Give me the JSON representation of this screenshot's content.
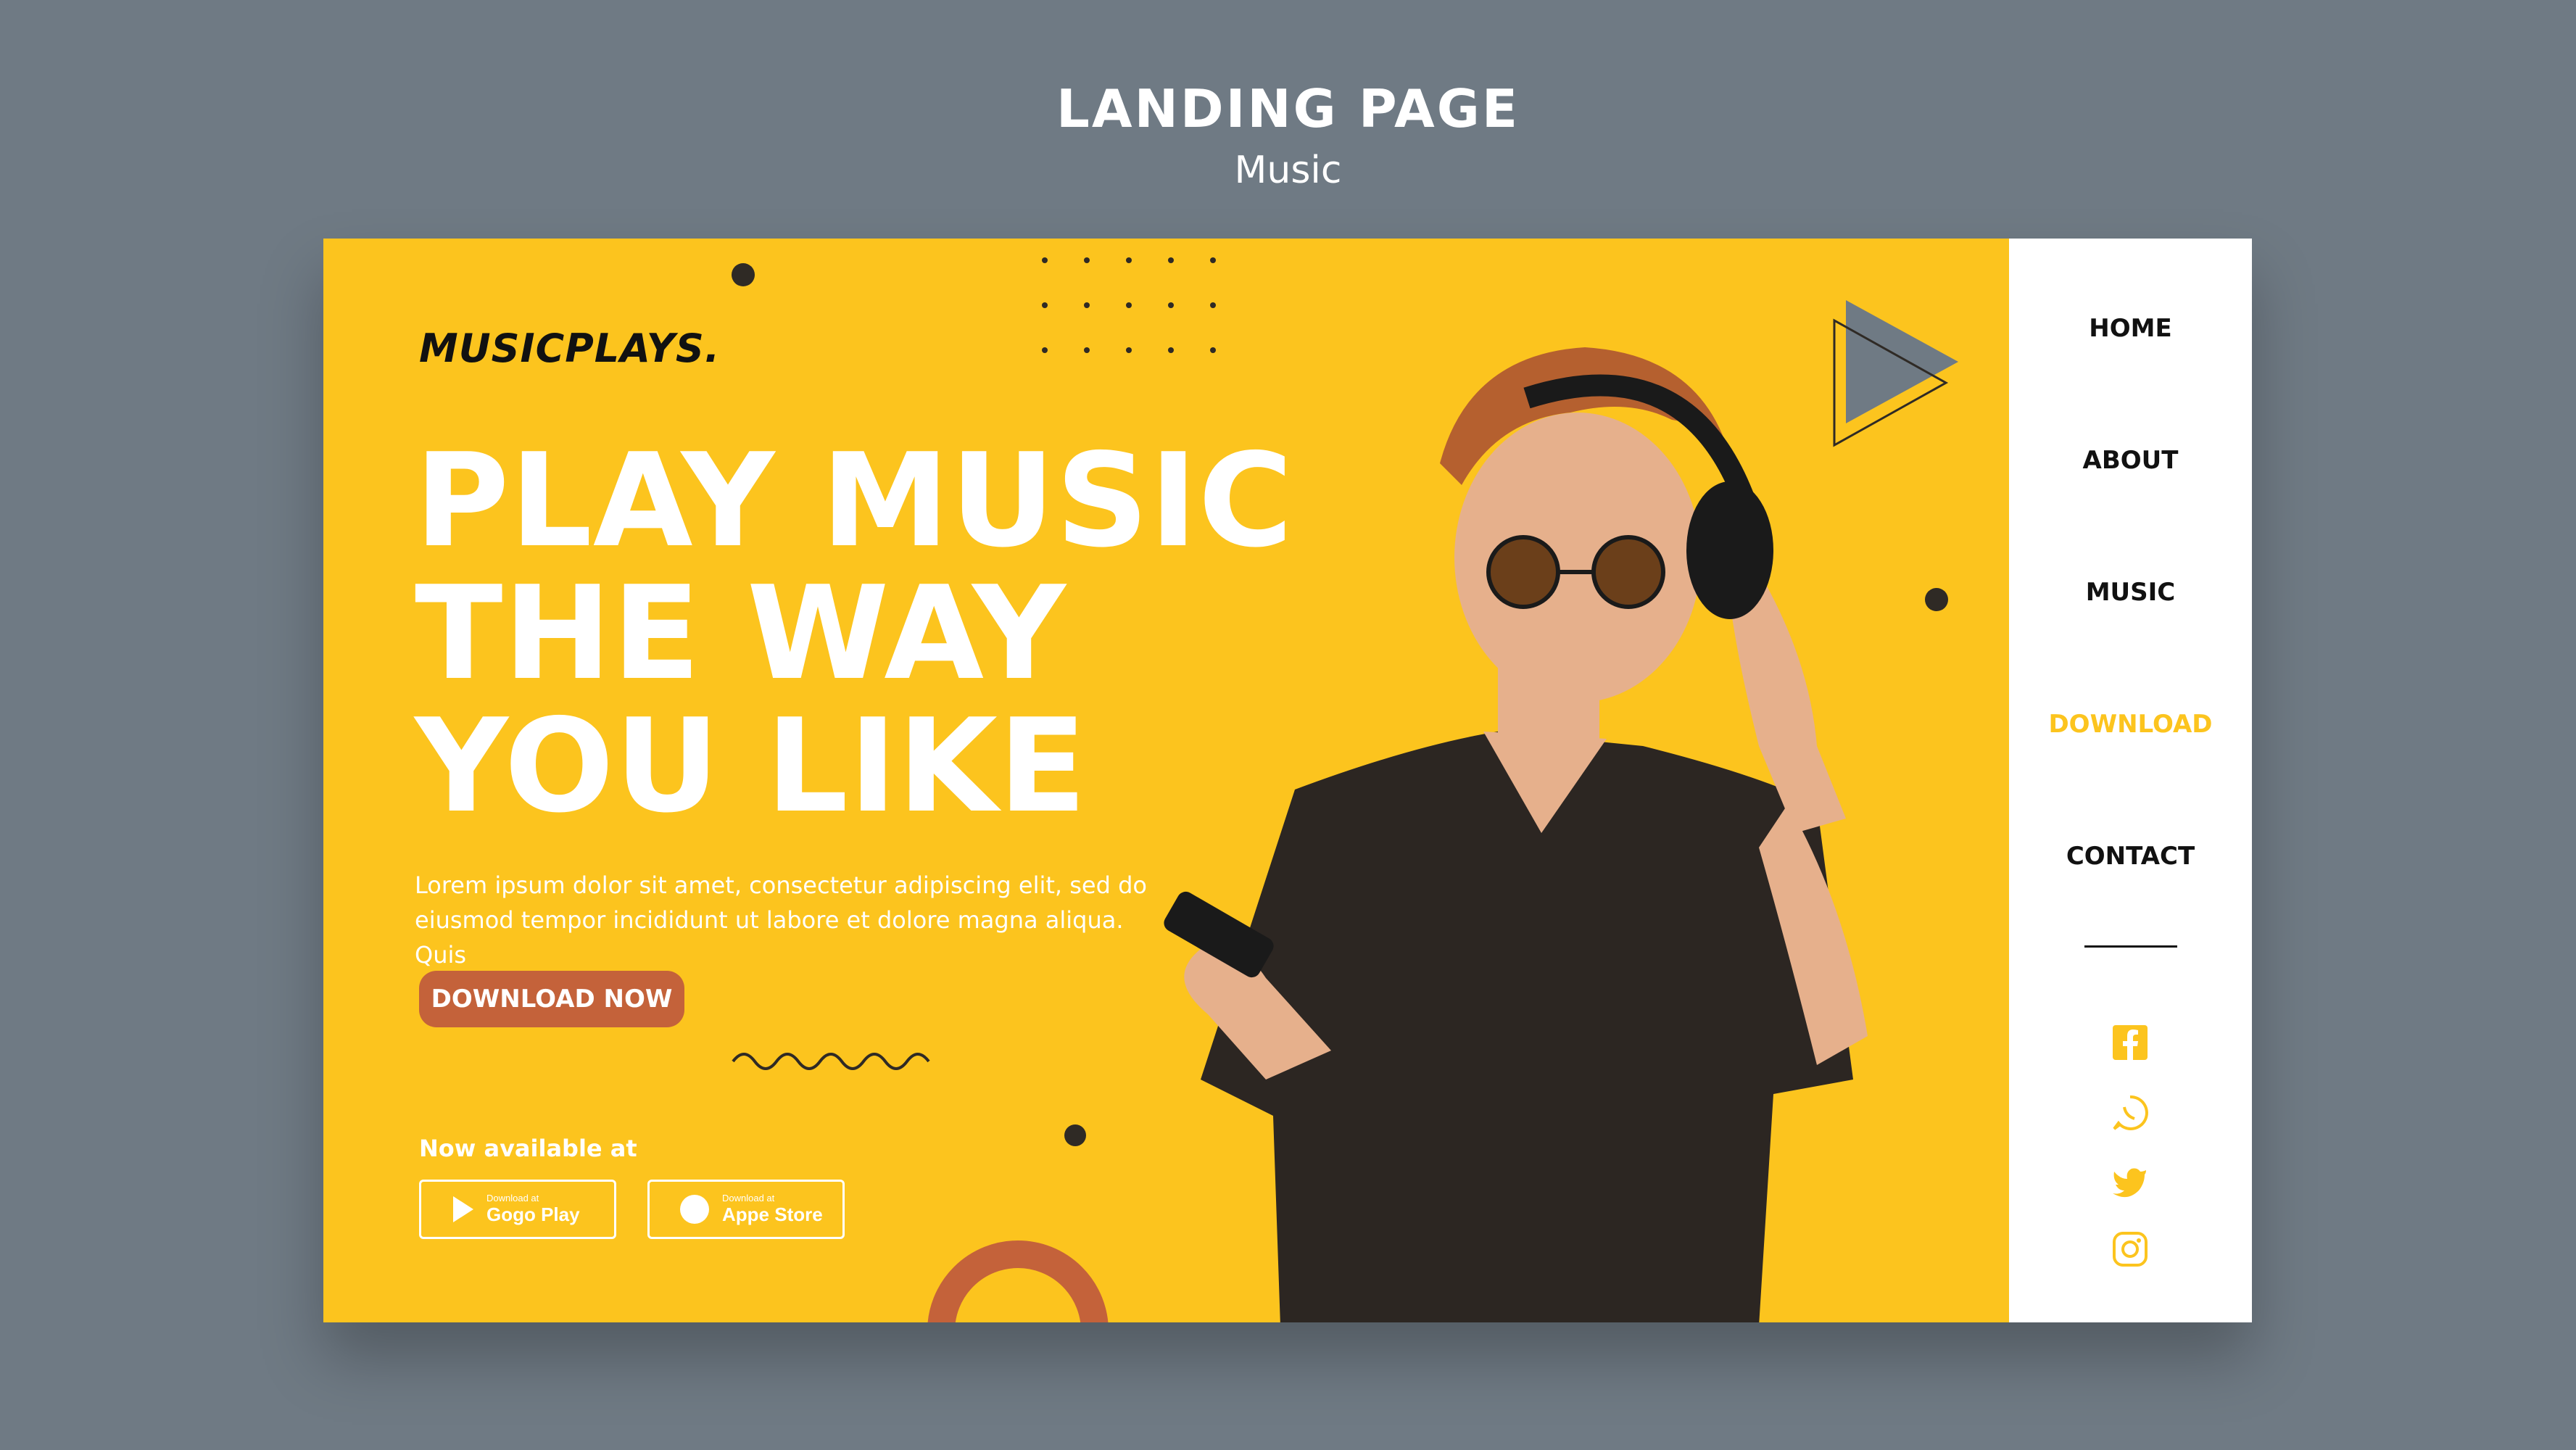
{
  "showcase": {
    "title": "LANDING PAGE",
    "subtitle": "Music"
  },
  "hero": {
    "brand": "MUSICPLAYS.",
    "headline_lines": [
      "PLAY MUSIC",
      "THE WAY",
      "YOU LIKE"
    ],
    "body_lines": [
      "Lorem ipsum dolor sit amet, consectetur adipiscing elit, sed do",
      "eiusmod tempor incididunt ut labore et dolore magna aliqua. Quis"
    ],
    "cta_label": "DOWNLOAD NOW",
    "available_label": "Now available at",
    "stores": [
      {
        "small": "Download at",
        "name": "Gogo Play",
        "icon": "play-triangle-icon"
      },
      {
        "small": "Download at",
        "name": "Appe Store",
        "icon": "apple-circle-icon"
      }
    ]
  },
  "nav": {
    "items": [
      {
        "label": "HOME",
        "active": false
      },
      {
        "label": "ABOUT",
        "active": false
      },
      {
        "label": "MUSIC",
        "active": false
      },
      {
        "label": "DOWNLOAD",
        "active": true
      },
      {
        "label": "CONTACT",
        "active": false
      }
    ],
    "social": [
      "facebook-icon",
      "whatsapp-icon",
      "twitter-icon",
      "instagram-icon"
    ]
  },
  "colors": {
    "background": "#6f7a84",
    "accent_yellow": "#fcc41e",
    "cta_orange": "#c4623a",
    "nav_bg": "#ffffff",
    "active_link": "#fcc41e",
    "dark": "#111111"
  }
}
